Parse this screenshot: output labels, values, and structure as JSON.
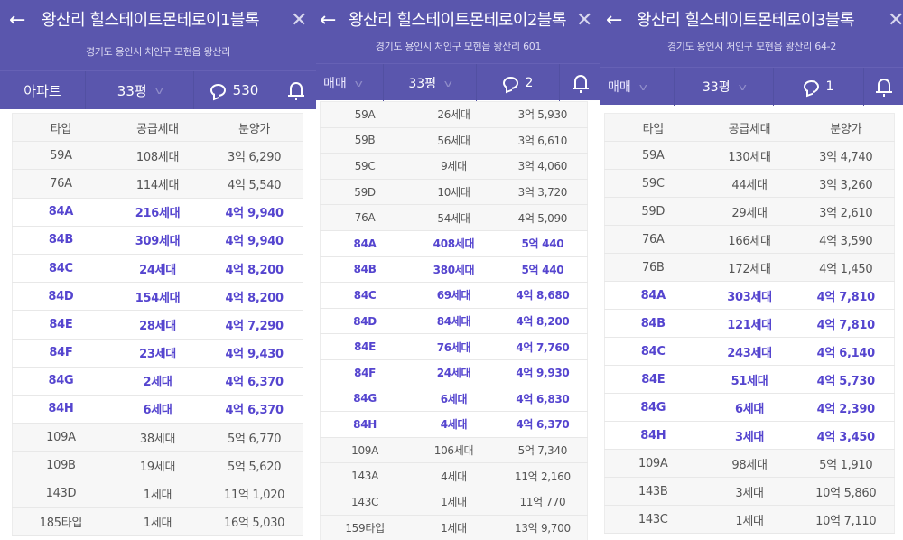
{
  "colors": {
    "header_bg": "#5a56ad",
    "highlight_text": "#5545cf",
    "row_gray": "#f7f7f7"
  },
  "icons": {
    "back": "arrow-left-icon",
    "close": "close-icon",
    "comment": "speech-bubble-icon",
    "alert": "bell-icon",
    "dropdown": "chevron-down-icon"
  },
  "panels": [
    {
      "title": "왕산리 힐스테이트몬테로이1블록",
      "address": "경기도 용인시 처인구 모현읍 왕산리",
      "filters": {
        "category": "아파트",
        "size": "33평",
        "comments": "530"
      },
      "columns": [
        "타입",
        "공급세대",
        "분양가"
      ],
      "rows": [
        {
          "type": "59A",
          "units": "108세대",
          "price": "3억 6,290",
          "highlight": false
        },
        {
          "type": "76A",
          "units": "114세대",
          "price": "4억 5,540",
          "highlight": false
        },
        {
          "type": "84A",
          "units": "216세대",
          "price": "4억 9,940",
          "highlight": true
        },
        {
          "type": "84B",
          "units": "309세대",
          "price": "4억 9,940",
          "highlight": true
        },
        {
          "type": "84C",
          "units": "24세대",
          "price": "4억 8,200",
          "highlight": true
        },
        {
          "type": "84D",
          "units": "154세대",
          "price": "4억 8,200",
          "highlight": true
        },
        {
          "type": "84E",
          "units": "28세대",
          "price": "4억 7,290",
          "highlight": true
        },
        {
          "type": "84F",
          "units": "23세대",
          "price": "4억 9,430",
          "highlight": true
        },
        {
          "type": "84G",
          "units": "2세대",
          "price": "4억 6,370",
          "highlight": true
        },
        {
          "type": "84H",
          "units": "6세대",
          "price": "4억 6,370",
          "highlight": true
        },
        {
          "type": "109A",
          "units": "38세대",
          "price": "5억 6,770",
          "highlight": false
        },
        {
          "type": "109B",
          "units": "19세대",
          "price": "5억 5,620",
          "highlight": false
        },
        {
          "type": "143D",
          "units": "1세대",
          "price": "11억 1,020",
          "highlight": false
        },
        {
          "type": "185타입",
          "units": "1세대",
          "price": "16억 5,030",
          "highlight": false
        }
      ]
    },
    {
      "title": "왕산리 힐스테이트몬테로이2블록",
      "address": "경기도 용인시 처인구 모현읍 왕산리 601",
      "filters": {
        "category": "매매",
        "size": "33평",
        "comments": "2"
      },
      "columns": [],
      "rows": [
        {
          "type": "59A",
          "units": "26세대",
          "price": "3억 5,930",
          "highlight": false
        },
        {
          "type": "59B",
          "units": "56세대",
          "price": "3억 6,610",
          "highlight": false
        },
        {
          "type": "59C",
          "units": "9세대",
          "price": "3억 4,060",
          "highlight": false
        },
        {
          "type": "59D",
          "units": "10세대",
          "price": "3억 3,720",
          "highlight": false
        },
        {
          "type": "76A",
          "units": "54세대",
          "price": "4억 5,090",
          "highlight": false
        },
        {
          "type": "84A",
          "units": "408세대",
          "price": "5억 440",
          "highlight": true
        },
        {
          "type": "84B",
          "units": "380세대",
          "price": "5억 440",
          "highlight": true
        },
        {
          "type": "84C",
          "units": "69세대",
          "price": "4억 8,680",
          "highlight": true
        },
        {
          "type": "84D",
          "units": "84세대",
          "price": "4억 8,200",
          "highlight": true
        },
        {
          "type": "84E",
          "units": "76세대",
          "price": "4억 7,760",
          "highlight": true
        },
        {
          "type": "84F",
          "units": "24세대",
          "price": "4억 9,930",
          "highlight": true
        },
        {
          "type": "84G",
          "units": "6세대",
          "price": "4억 6,830",
          "highlight": true
        },
        {
          "type": "84H",
          "units": "4세대",
          "price": "4억 6,370",
          "highlight": true
        },
        {
          "type": "109A",
          "units": "106세대",
          "price": "5억 7,340",
          "highlight": false
        },
        {
          "type": "143A",
          "units": "4세대",
          "price": "11억 2,160",
          "highlight": false
        },
        {
          "type": "143C",
          "units": "1세대",
          "price": "11억 770",
          "highlight": false
        },
        {
          "type": "159타입",
          "units": "1세대",
          "price": "13억 9,700",
          "highlight": false
        }
      ]
    },
    {
      "title": "왕산리 힐스테이트몬테로이3블록",
      "address": "경기도 용인시 처인구 모현읍 왕산리 64-2",
      "filters": {
        "category": "매매",
        "size": "33평",
        "comments": "1"
      },
      "columns": [
        "타입",
        "공급세대",
        "분양가"
      ],
      "rows": [
        {
          "type": "59A",
          "units": "130세대",
          "price": "3억 4,740",
          "highlight": false
        },
        {
          "type": "59C",
          "units": "44세대",
          "price": "3억 3,260",
          "highlight": false
        },
        {
          "type": "59D",
          "units": "29세대",
          "price": "3억 2,610",
          "highlight": false
        },
        {
          "type": "76A",
          "units": "166세대",
          "price": "4억 3,590",
          "highlight": false
        },
        {
          "type": "76B",
          "units": "172세대",
          "price": "4억 1,450",
          "highlight": false
        },
        {
          "type": "84A",
          "units": "303세대",
          "price": "4억 7,810",
          "highlight": true
        },
        {
          "type": "84B",
          "units": "121세대",
          "price": "4억 7,810",
          "highlight": true
        },
        {
          "type": "84C",
          "units": "243세대",
          "price": "4억 6,140",
          "highlight": true
        },
        {
          "type": "84E",
          "units": "51세대",
          "price": "4억 5,730",
          "highlight": true
        },
        {
          "type": "84G",
          "units": "6세대",
          "price": "4억 2,390",
          "highlight": true
        },
        {
          "type": "84H",
          "units": "3세대",
          "price": "4억 3,450",
          "highlight": true
        },
        {
          "type": "109A",
          "units": "98세대",
          "price": "5억 1,910",
          "highlight": false
        },
        {
          "type": "143B",
          "units": "3세대",
          "price": "10억 5,860",
          "highlight": false
        },
        {
          "type": "143C",
          "units": "1세대",
          "price": "10억 7,110",
          "highlight": false
        }
      ]
    }
  ]
}
